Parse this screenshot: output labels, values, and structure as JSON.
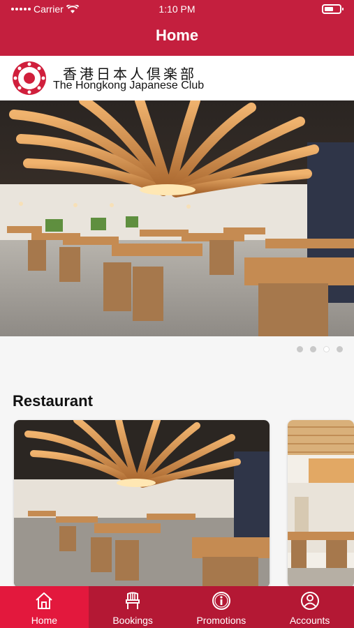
{
  "status_bar": {
    "carrier": "Carrier",
    "time": "1:10 PM"
  },
  "nav": {
    "title": "Home"
  },
  "header": {
    "logo_japanese": "香港日本人倶楽部",
    "logo_english": "The Hongkong Japanese Club"
  },
  "hero": {
    "page_count": 4,
    "active_page": 3
  },
  "restaurant": {
    "title": "Restaurant"
  },
  "tabs": [
    {
      "label": "Home",
      "icon": "home-icon",
      "active": true
    },
    {
      "label": "Bookings",
      "icon": "chair-icon",
      "active": false
    },
    {
      "label": "Promotions",
      "icon": "info-icon",
      "active": false
    },
    {
      "label": "Accounts",
      "icon": "user-icon",
      "active": false
    }
  ],
  "colors": {
    "brand_red": "#c41f3e",
    "tab_bar": "#b41834",
    "tab_active": "#e3183d"
  }
}
